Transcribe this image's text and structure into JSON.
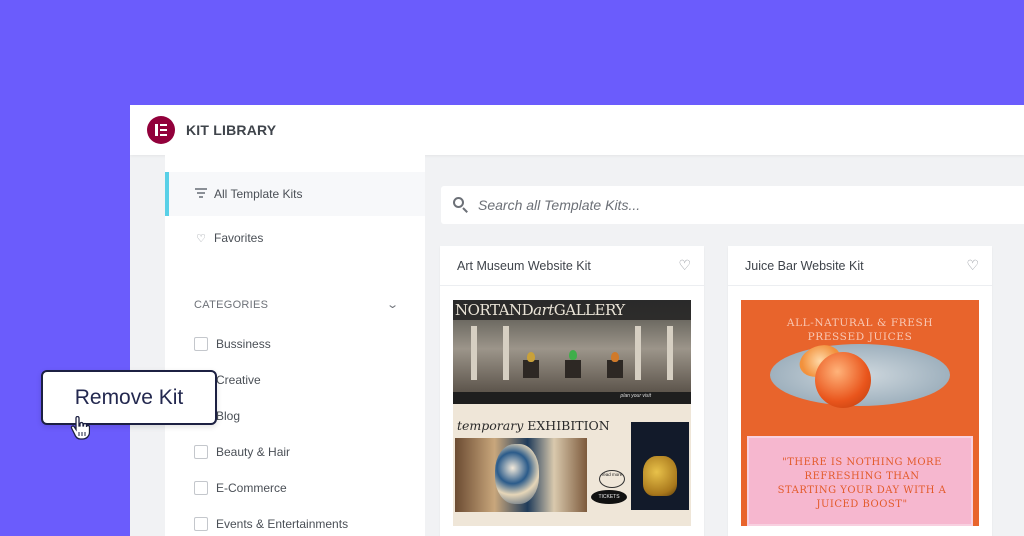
{
  "header": {
    "title": "KIT LIBRARY",
    "logo_icon": "elementor-logo-icon"
  },
  "sidebar": {
    "nav": [
      {
        "label": "All Template Kits",
        "icon": "filter-icon",
        "active": true
      },
      {
        "label": "Favorites",
        "icon": "heart-icon",
        "active": false
      }
    ],
    "categories_label": "CATEGORIES",
    "categories": [
      {
        "label": "Bussiness",
        "checked": false
      },
      {
        "label": "Creative",
        "checked": false
      },
      {
        "label": "Blog",
        "checked": false
      },
      {
        "label": "Beauty & Hair",
        "checked": false
      },
      {
        "label": "E-Commerce",
        "checked": false
      },
      {
        "label": "Events & Entertainments",
        "checked": false
      }
    ]
  },
  "search": {
    "placeholder": "Search all Template Kits..."
  },
  "kits": [
    {
      "name": "Art Museum Website Kit",
      "thumb": {
        "gallery_pre": "NORTAND",
        "gallery_art": "art",
        "gallery_post": "GALLERY",
        "visit_text": "plan your visit",
        "exhibition_pre": "temporary",
        "exhibition_post": "EXHIBITION",
        "read_more": "read more",
        "tickets": "TICKETS"
      }
    },
    {
      "name": "Juice Bar Website Kit",
      "thumb": {
        "headline_1": "ALL-NATURAL & FRESH",
        "headline_2": "PRESSED JUICES",
        "quote_1": "\"THERE IS NOTHING MORE",
        "quote_2": "REFRESHING THAN",
        "quote_3": "STARTING YOUR DAY WITH A",
        "quote_4": "JUICED BOOST\""
      }
    }
  ],
  "overlay": {
    "button_label": "Remove Kit",
    "cursor_icon": "hand-pointer-icon"
  },
  "colors": {
    "background": "#6b5cfc",
    "logo": "#92003b",
    "active_indicator": "#58d0e7",
    "overlay_border": "#1c2042"
  }
}
